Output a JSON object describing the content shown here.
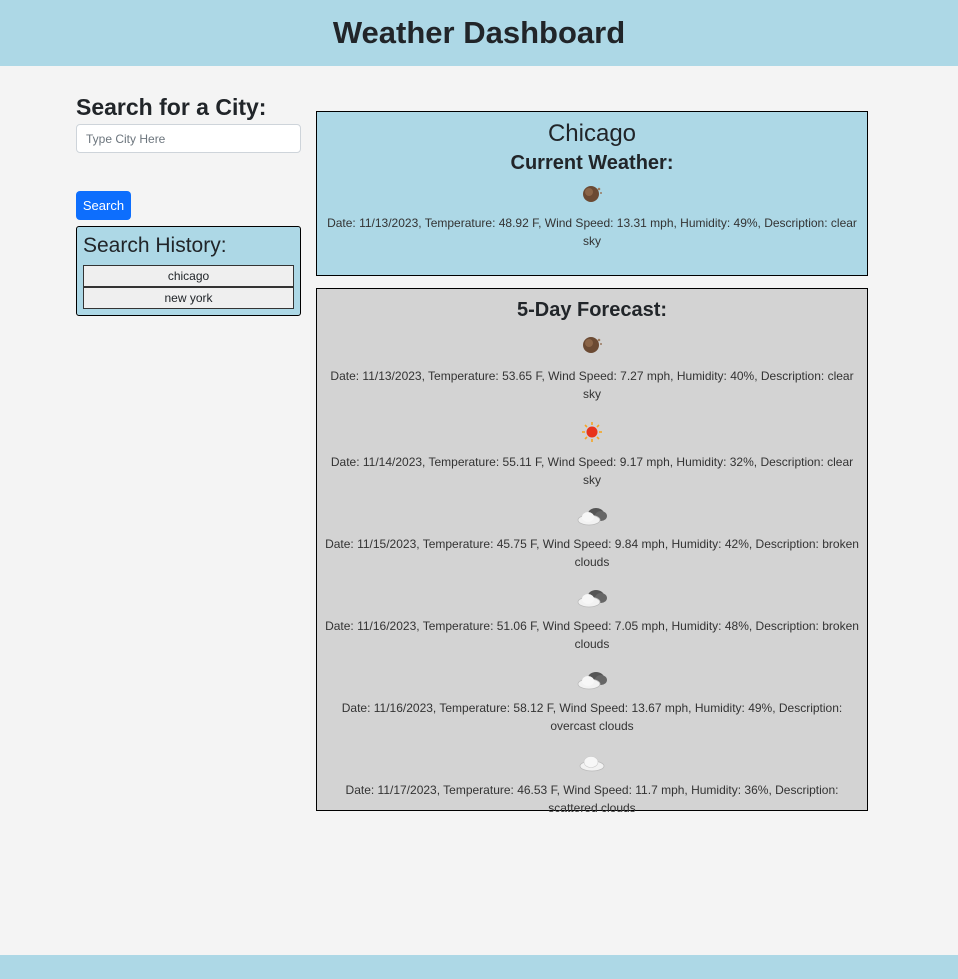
{
  "header": {
    "title": "Weather Dashboard"
  },
  "search": {
    "title": "Search for a City:",
    "placeholder": "Type City Here",
    "value": "",
    "button_label": "Search"
  },
  "history": {
    "title": "Search History:",
    "items": [
      {
        "label": "chicago"
      },
      {
        "label": "new york"
      }
    ]
  },
  "current": {
    "city": "Chicago",
    "heading": "Current Weather:",
    "icon": "clear-night-icon",
    "text": "Date: 11/13/2023, Temperature: 48.92 F, Wind Speed: 13.31 mph, Humidity: 49%, Description: clear sky"
  },
  "forecast": {
    "heading": "5-Day Forecast:",
    "items": [
      {
        "icon": "clear-night-icon",
        "text": "Date: 11/13/2023, Temperature: 53.65 F, Wind Speed: 7.27 mph, Humidity: 40%, Description: clear sky"
      },
      {
        "icon": "clear-day-icon",
        "text": "Date: 11/14/2023, Temperature: 55.11 F, Wind Speed: 9.17 mph, Humidity: 32%, Description: clear sky"
      },
      {
        "icon": "broken-clouds-icon",
        "text": "Date: 11/15/2023, Temperature: 45.75 F, Wind Speed: 9.84 mph, Humidity: 42%, Description: broken clouds"
      },
      {
        "icon": "broken-clouds-icon",
        "text": "Date: 11/16/2023, Temperature: 51.06 F, Wind Speed: 7.05 mph, Humidity: 48%, Description: broken clouds"
      },
      {
        "icon": "broken-clouds-icon",
        "text": "Date: 11/16/2023, Temperature: 58.12 F, Wind Speed: 13.67 mph, Humidity: 49%, Description: overcast clouds"
      },
      {
        "icon": "scattered-clouds-icon",
        "text": "Date: 11/17/2023, Temperature: 46.53 F, Wind Speed: 11.7 mph, Humidity: 36%, Description: scattered clouds"
      }
    ]
  },
  "colors": {
    "header_bg": "#add8e6",
    "page_bg": "#f4f4f4",
    "button_bg": "#0d6efd",
    "forecast_bg": "#d3d3d3"
  }
}
